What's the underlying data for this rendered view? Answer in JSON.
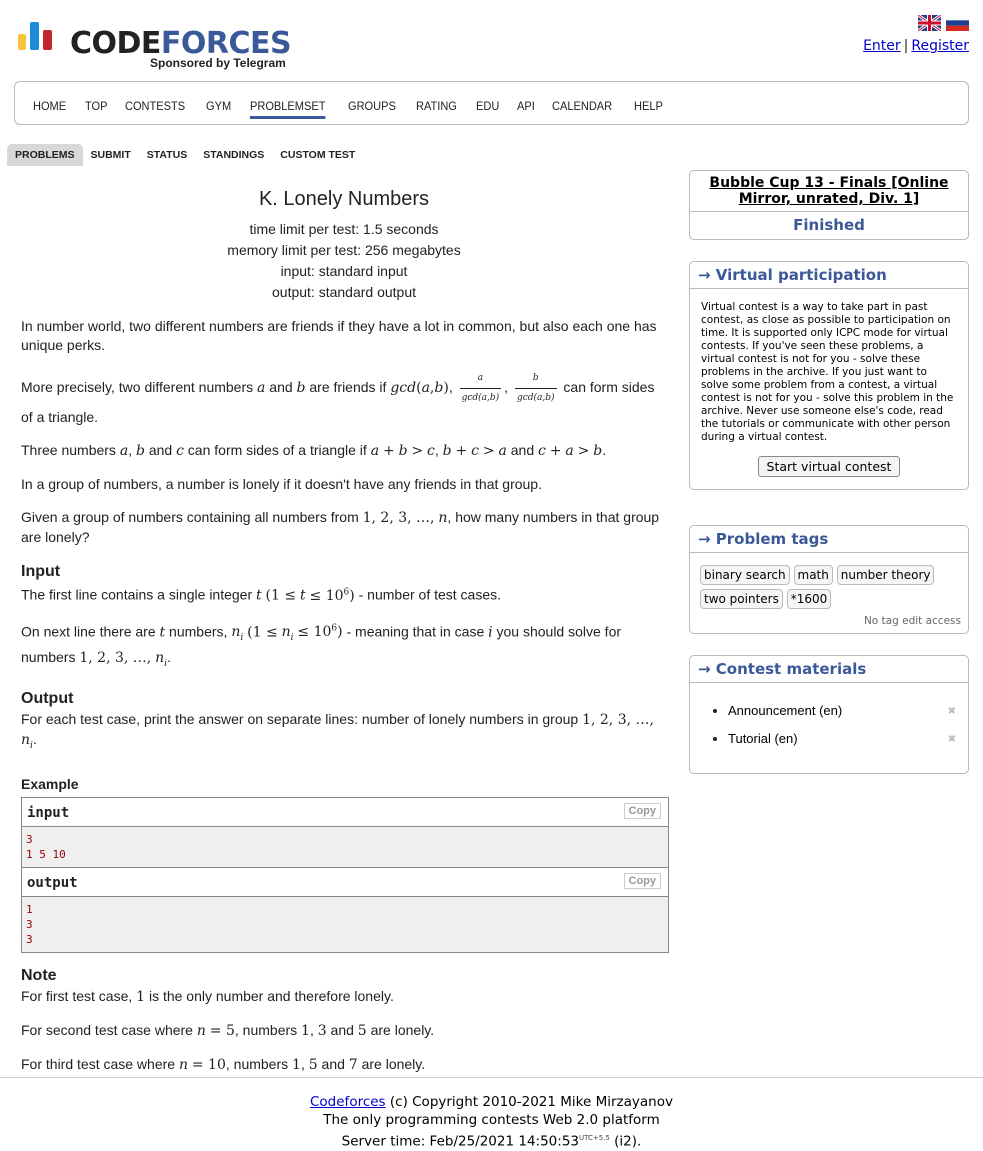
{
  "header": {
    "logo_word1": "CODE",
    "logo_word2": "FORCES",
    "sponsor": "Sponsored by Telegram",
    "enter": "Enter",
    "separator": "|",
    "register": "Register",
    "flags": [
      "uk-flag-icon",
      "ru-flag-icon"
    ]
  },
  "menu": {
    "items": [
      "HOME",
      "TOP",
      "CONTESTS",
      "GYM",
      "PROBLEMSET",
      "GROUPS",
      "RATING",
      "EDU",
      "API",
      "CALENDAR",
      "HELP"
    ],
    "active": "PROBLEMSET"
  },
  "submenu": {
    "items": [
      "PROBLEMS",
      "SUBMIT",
      "STATUS",
      "STANDINGS",
      "CUSTOM TEST"
    ],
    "active": "PROBLEMS"
  },
  "problem": {
    "title": "K. Lonely Numbers",
    "time_limit": "time limit per test: 1.5 seconds",
    "memory_limit": "memory limit per test: 256 megabytes",
    "input_file": "input: standard input",
    "output_file": "output: standard output",
    "statement_1": "In number world, two different numbers are friends if they have a lot in common, but also each one has unique perks.",
    "statement_4": "In a group of numbers, a number is lonely if it doesn't have any friends in that group.",
    "input_title": "Input",
    "output_title": "Output",
    "example_title": "Example",
    "input_label": "input",
    "output_label": "output",
    "copy": "Copy",
    "sample_input": "3\n1 5 10",
    "sample_output": "1\n3\n3",
    "note_title": "Note"
  },
  "sidebar": {
    "contest_name": "Bubble Cup 13 - Finals [Online Mirror, unrated, Div. 1]",
    "contest_status": "Finished",
    "virtual_title": "→ Virtual participation",
    "virtual_text": "Virtual contest is a way to take part in past contest, as close as possible to participation on time. It is supported only ICPC mode for virtual contests. If you've seen these problems, a virtual contest is not for you - solve these problems in the archive. If you just want to solve some problem from a contest, a virtual contest is not for you - solve this problem in the archive. Never use someone else's code, read the tutorials or communicate with other person during a virtual contest.",
    "virtual_button": "Start virtual contest",
    "tags_title": "→ Problem tags",
    "tags": [
      "binary search",
      "math",
      "number theory",
      "two pointers",
      "*1600"
    ],
    "no_edit": "No tag edit access",
    "materials_title": "→ Contest materials",
    "materials": [
      "Announcement (en)",
      "Tutorial (en)"
    ]
  },
  "footer": {
    "link": "Codeforces",
    "copyright": " (c) Copyright 2010-2021 Mike Mirzayanov",
    "line2": "The only programming contests Web 2.0 platform",
    "server_time": "Server time: Feb/25/2021 14:50:53",
    "utc": "UTC+5.5",
    "instance": " (i2)."
  },
  "colors": {
    "accent": "#3b5998",
    "sample_text": "#990000",
    "logo_yellow": "#f6c43d",
    "logo_blue": "#1a8cd8",
    "logo_red": "#c4262e"
  }
}
